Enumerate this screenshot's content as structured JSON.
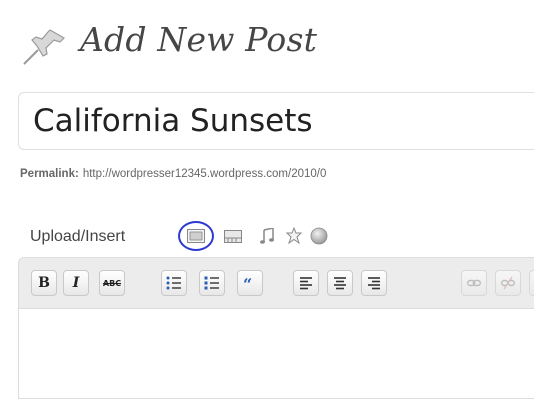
{
  "header": {
    "title": "Add New Post",
    "icon": "pushpin-icon"
  },
  "post": {
    "title_value": "California Sunsets",
    "permalink_label": "Permalink:",
    "permalink_url": "http://wordpresser12345.wordpress.com/2010/0"
  },
  "upload": {
    "label": "Upload/Insert",
    "icons": [
      "add-image-icon",
      "add-video-icon",
      "add-audio-icon",
      "add-media-icon",
      "add-other-icon"
    ],
    "highlight_color": "#2e39d0"
  },
  "toolbar": {
    "bold_label": "B",
    "italic_label": "I",
    "strike_label": "ABC",
    "buttons": [
      "bold",
      "italic",
      "strikethrough",
      "bullet-list",
      "numbered-list",
      "blockquote",
      "align-left",
      "align-center",
      "align-right",
      "insert-link",
      "unlink"
    ]
  },
  "colors": {
    "title_text": "#464646",
    "toolbar_bg": "#ececec",
    "quote_blue": "#2a5db0"
  }
}
